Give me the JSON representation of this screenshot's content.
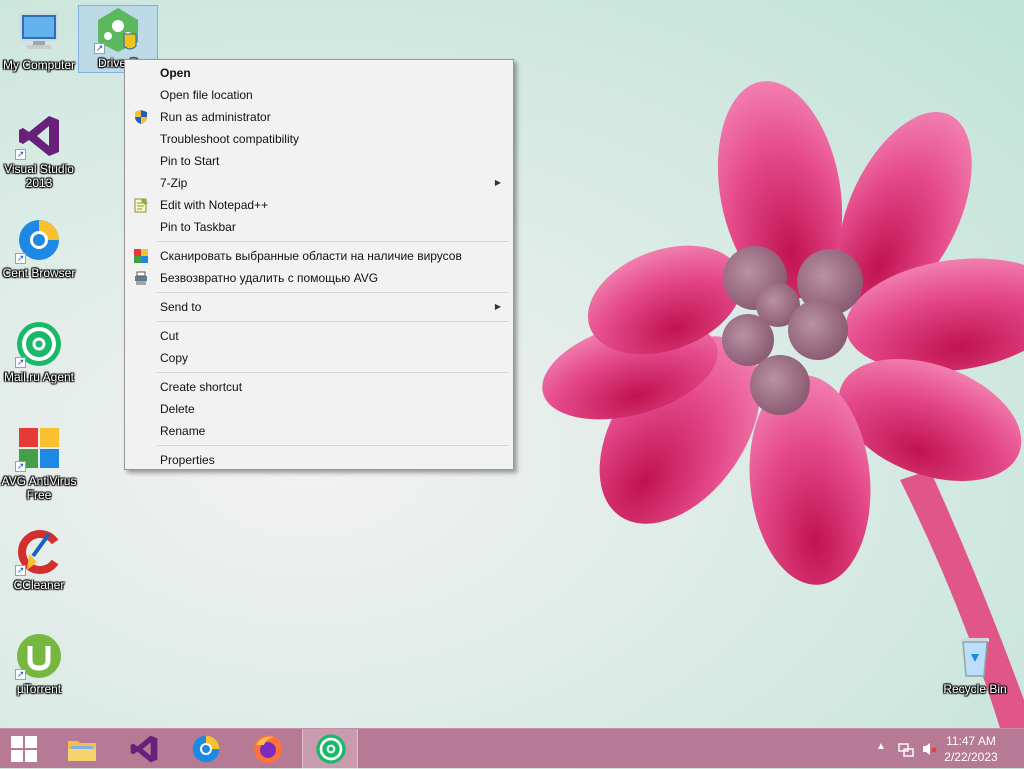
{
  "desktop": {
    "icons": [
      {
        "label": "My Computer"
      },
      {
        "label": "DriverP"
      },
      {
        "label": "Visual Studio 2013"
      },
      {
        "label": "Cent Browser"
      },
      {
        "label": "Mail.ru Agent"
      },
      {
        "label": "AVG AntiVirus Free"
      },
      {
        "label": "CCleaner"
      },
      {
        "label": "µTorrent"
      },
      {
        "label": "Recycle Bin"
      }
    ]
  },
  "context_menu": {
    "items": [
      {
        "label": "Open"
      },
      {
        "label": "Open file location"
      },
      {
        "label": "Run as administrator",
        "icon": "uac-shield-icon"
      },
      {
        "label": "Troubleshoot compatibility"
      },
      {
        "label": "Pin to Start"
      },
      {
        "label": "7-Zip",
        "submenu": true
      },
      {
        "label": "Edit with Notepad++",
        "icon": "notepad-plus-plus-icon"
      },
      {
        "label": "Pin to Taskbar"
      },
      {
        "label": "Сканировать выбранные области на наличие вирусов",
        "icon": "avg-scan-icon"
      },
      {
        "label": "Безвозвратно удалить с помощью AVG",
        "icon": "avg-shredder-icon"
      },
      {
        "label": "Send to",
        "submenu": true
      },
      {
        "label": "Cut"
      },
      {
        "label": "Copy"
      },
      {
        "label": "Create shortcut"
      },
      {
        "label": "Delete"
      },
      {
        "label": "Rename"
      },
      {
        "label": "Properties"
      }
    ]
  },
  "taskbar": {
    "clock_time": "11:47 AM",
    "clock_date": "2/22/2023",
    "tray_arrow": "▲",
    "colors": {
      "taskbar": "#b77a94"
    }
  }
}
